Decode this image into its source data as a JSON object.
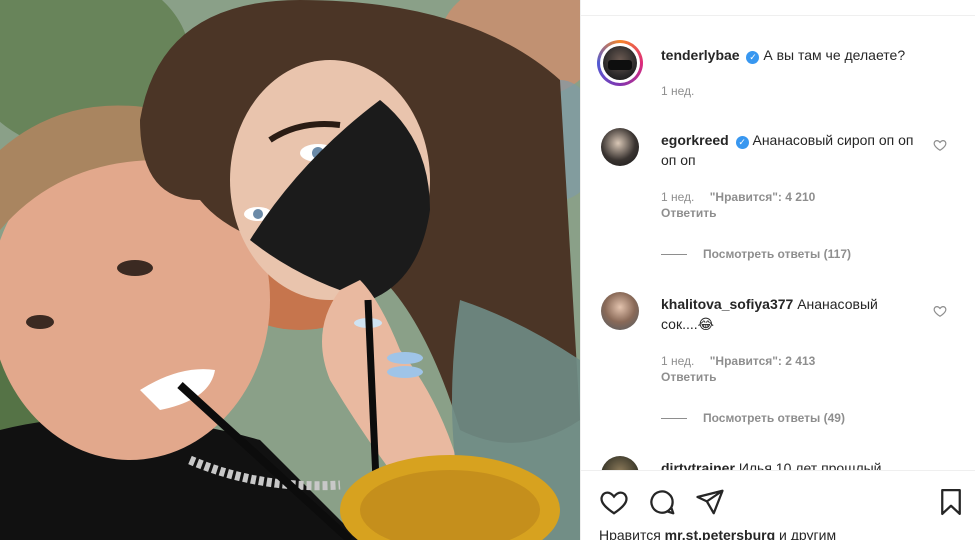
{
  "post": {
    "author": "tenderlybae",
    "caption": "А вы там че делаете?",
    "time": "1 нед."
  },
  "comments": [
    {
      "username": "egorkreed",
      "verified": true,
      "text": "Ананасовый сироп оп оп оп оп",
      "time": "1 нед.",
      "likes": "\"Нравится\": 4 210",
      "reply": "Ответить",
      "view_replies": "Посмотреть ответы (117)"
    },
    {
      "username": "khalitova_sofiya377",
      "verified": false,
      "text": "Ананасовый сок....😂",
      "time": "1 нед.",
      "likes": "\"Нравится\": 2 413",
      "reply": "Ответить",
      "view_replies": "Посмотреть ответы (49)"
    },
    {
      "username": "dirtytrainer",
      "text": "Илья 10 лет прошлый"
    }
  ],
  "footer": {
    "liked_prefix": "Нравится",
    "liked_user": "mr.st.petersburg",
    "liked_suffix": "и другим"
  },
  "icons": {
    "like": "heart-icon",
    "comment": "comment-icon",
    "share": "share-icon",
    "save": "bookmark-icon",
    "verified": "verified-badge-icon"
  },
  "colors": {
    "verified": "#3897f0",
    "secondary_text": "#8e8e8e",
    "primary_text": "#262626"
  }
}
